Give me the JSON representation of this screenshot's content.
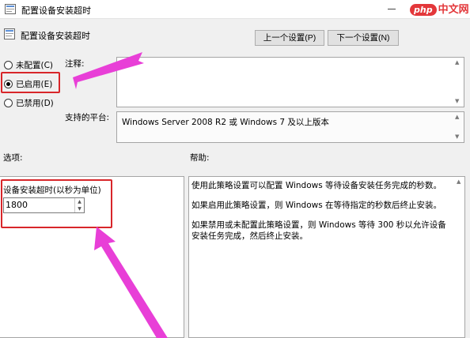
{
  "window": {
    "title": "配置设备安装超时",
    "watermark_php": "php",
    "watermark_cn": "中文网"
  },
  "header": {
    "title": "配置设备安装超时",
    "prev_label": "上一个设置(P)",
    "next_label": "下一个设置(N)"
  },
  "state": {
    "options": [
      {
        "label": "未配置(C)",
        "checked": false
      },
      {
        "label": "已启用(E)",
        "checked": true
      },
      {
        "label": "已禁用(D)",
        "checked": false
      }
    ]
  },
  "comment": {
    "label": "注释:",
    "value": ""
  },
  "platform": {
    "label": "支持的平台:",
    "value": "Windows Server 2008 R2 或 Windows 7 及以上版本"
  },
  "options_pane": {
    "label": "选项:",
    "caption": "设备安装超时(以秒为单位)",
    "timeout_value": "1800"
  },
  "help_pane": {
    "label": "帮助:",
    "paragraphs": [
      "使用此策略设置可以配置 Windows 等待设备安装任务完成的秒数。",
      "如果启用此策略设置，则 Windows 在等待指定的秒数后终止安装。",
      "如果禁用或未配置此策略设置，则 Windows 等待 300 秒以允许设备安装任务完成，然后终止安装。"
    ]
  },
  "colors": {
    "highlight": "#d8262a",
    "arrow": "#e83fd7",
    "brand": "#e3373a"
  }
}
